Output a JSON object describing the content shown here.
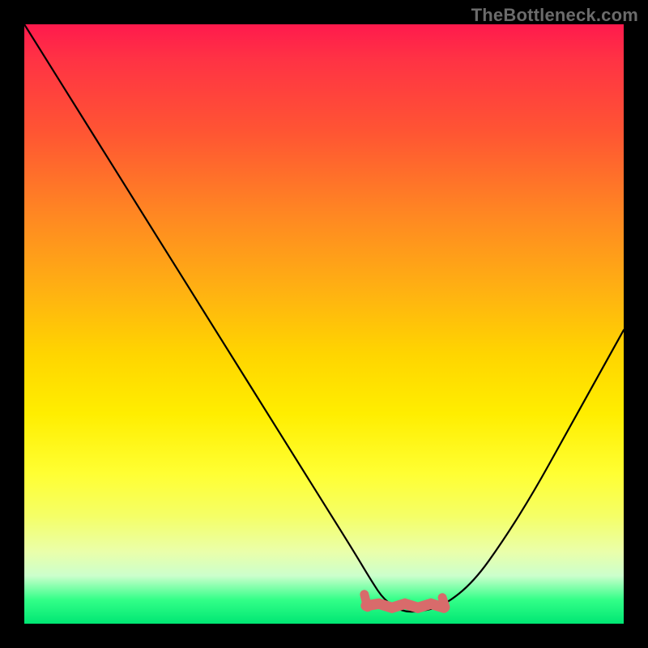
{
  "watermark": "TheBottleneck.com",
  "colors": {
    "background": "#000000",
    "gradient_top": "#ff1a4d",
    "gradient_bottom": "#00e673",
    "curve": "#000000",
    "accent_band": "#d86b6b"
  },
  "chart_data": {
    "type": "line",
    "title": "",
    "xlabel": "",
    "ylabel": "",
    "xlim": [
      0,
      100
    ],
    "ylim": [
      0,
      100
    ],
    "grid": false,
    "legend": false,
    "series": [
      {
        "name": "bottleneck-curve",
        "x": [
          0,
          5,
          10,
          15,
          20,
          25,
          30,
          35,
          40,
          45,
          50,
          55,
          58,
          60,
          63,
          66,
          70,
          75,
          80,
          85,
          90,
          95,
          100
        ],
        "y": [
          100,
          92,
          84,
          76,
          68,
          60,
          52,
          44,
          36,
          28,
          20,
          12,
          7,
          4,
          2,
          2,
          3,
          7,
          14,
          22,
          31,
          40,
          49
        ]
      }
    ],
    "annotations": [
      {
        "name": "optimal-band",
        "x_range": [
          57,
          70
        ],
        "y": 3,
        "style": "thick-pink-band"
      }
    ]
  }
}
